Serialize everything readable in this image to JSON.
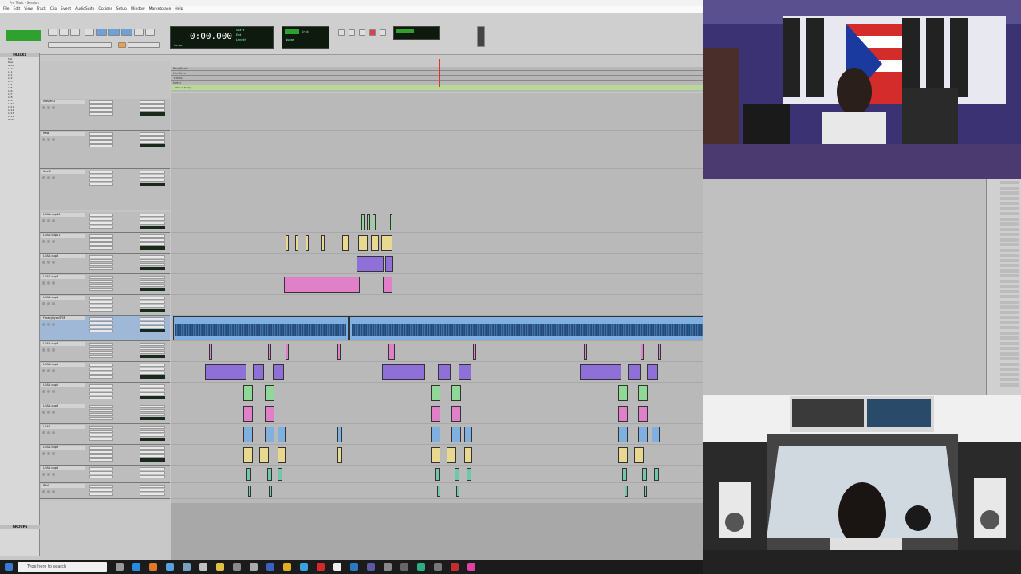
{
  "window": {
    "title": "Pro Tools - Session"
  },
  "menu": [
    "File",
    "Edit",
    "View",
    "Track",
    "Clip",
    "Event",
    "AudioSuite",
    "Options",
    "Setup",
    "Window",
    "Marketplace",
    "Help"
  ],
  "counter": {
    "main": "0:00.000",
    "start_label": "Start",
    "end_label": "End",
    "length_label": "Length",
    "cursor_label": "Cursor",
    "nudge_label": "Nudge",
    "grid_label": "Grid"
  },
  "tracklist": {
    "header": "TRACKS",
    "groups_header": "GROUPS",
    "items": [
      "Mst",
      "Raw",
      "Aux1",
      "L10",
      "L11",
      "LE1",
      "LE2",
      "LE3",
      "LE4",
      "LE5",
      "LE6",
      "LE7",
      "LE8",
      "LE9",
      "LE10",
      "LE11",
      "LE12",
      "LE13",
      "LE14",
      "RAW"
    ]
  },
  "ruler": {
    "rows": [
      "Bars|Beats",
      "Min:Secs",
      "Tempo",
      "Meter",
      "Markers"
    ],
    "tempo_label": "Manual tempo"
  },
  "tracks": [
    {
      "name": "Master 2",
      "kind": "master"
    },
    {
      "name": "Raw",
      "kind": "aux"
    },
    {
      "name": "Aux 1",
      "kind": "aux"
    },
    {
      "name": "LEAD.dup10",
      "kind": "audio"
    },
    {
      "name": "LEAD.dup11",
      "kind": "audio"
    },
    {
      "name": "LEAD.dup8",
      "kind": "audio"
    },
    {
      "name": "LEAD.dup7",
      "kind": "audio"
    },
    {
      "name": "LEAD.dup1",
      "kind": "audio"
    },
    {
      "name": "FreakyRyanSFM",
      "kind": "audio"
    },
    {
      "name": "LEAD.dup6",
      "kind": "audio"
    },
    {
      "name": "LEAD.dup5",
      "kind": "audio"
    },
    {
      "name": "LEAD.dup2",
      "kind": "audio"
    },
    {
      "name": "LEAD.dup3",
      "kind": "audio"
    },
    {
      "name": "LEAD",
      "kind": "audio"
    },
    {
      "name": "LEAD.dup9",
      "kind": "audio"
    },
    {
      "name": "LEAD.dup4",
      "kind": "audio"
    },
    {
      "name": "RAW",
      "kind": "audio"
    }
  ],
  "taskbar": {
    "search_placeholder": "Type here to search"
  },
  "colors": {
    "accent": "#39ff5a",
    "selection": "#9fb8d8",
    "clip_purple": "#8f70d8",
    "clip_pink": "#e080c8",
    "clip_blue": "#7fb0e0",
    "playhead": "#dd3333"
  }
}
